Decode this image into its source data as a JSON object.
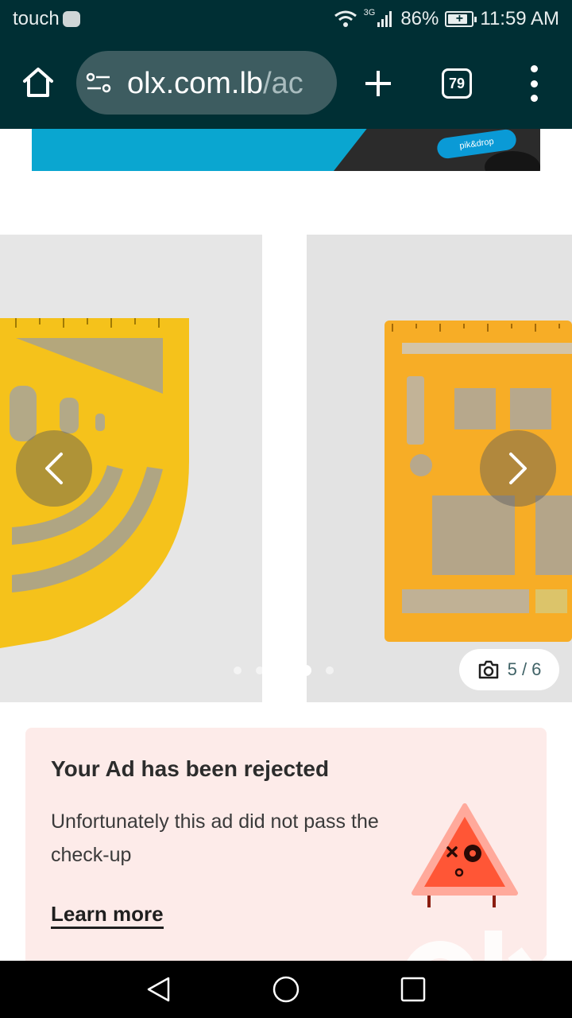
{
  "status_bar": {
    "carrier": "touch",
    "network": "3G",
    "battery": "86%",
    "battery_level": 0.86,
    "time": "11:59 AM"
  },
  "browser": {
    "url_host": "olx.com.lb",
    "url_path": "/ac",
    "tab_count": "79"
  },
  "gallery": {
    "current": 5,
    "total": 6,
    "counter": "5 / 6",
    "dots": 5,
    "active_dot": 3
  },
  "notice": {
    "title": "Your Ad has been rejected",
    "body": "Unfortunately this ad did not pass the check-up",
    "link": "Learn more"
  },
  "colors": {
    "toolbar": "#002f34",
    "notice_bg": "#fdebe9",
    "warning": "#ff5636",
    "banner": "#0aa6d0"
  }
}
